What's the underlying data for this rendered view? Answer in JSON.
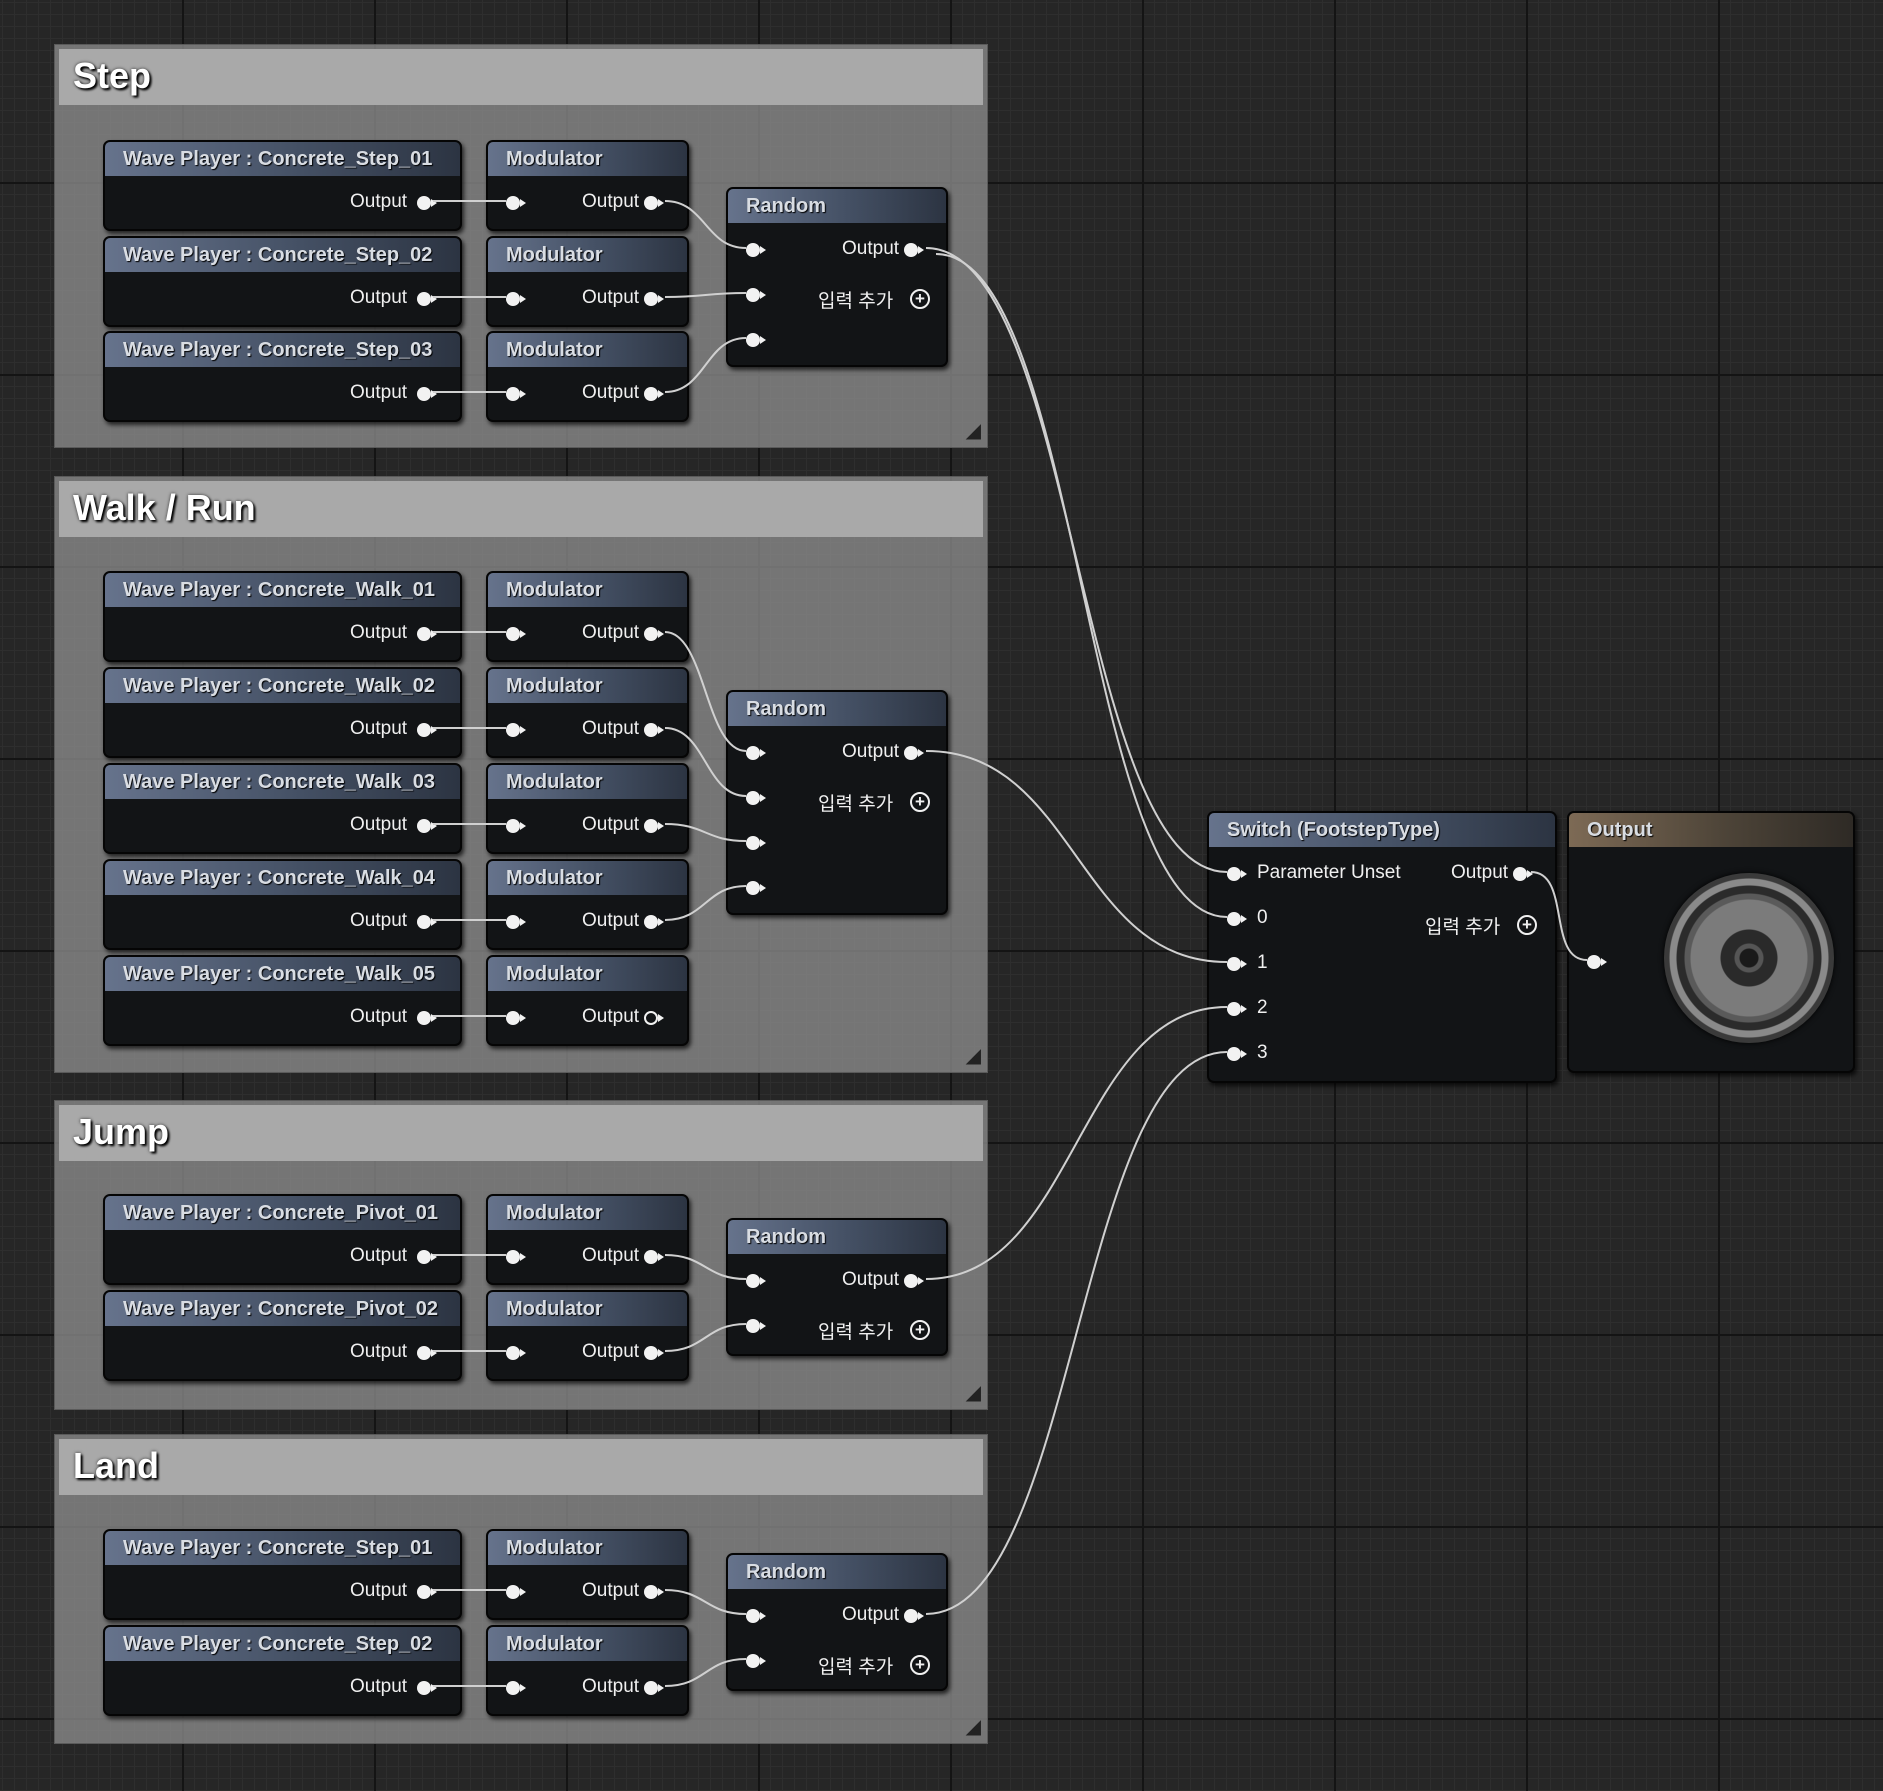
{
  "groups": [
    {
      "title": "Step",
      "wave_players": [
        "Wave Player : Concrete_Step_01",
        "Wave Player : Concrete_Step_02",
        "Wave Player : Concrete_Step_03"
      ]
    },
    {
      "title": "Walk / Run",
      "wave_players": [
        "Wave Player : Concrete_Walk_01",
        "Wave Player : Concrete_Walk_02",
        "Wave Player : Concrete_Walk_03",
        "Wave Player : Concrete_Walk_04",
        "Wave Player : Concrete_Walk_05"
      ]
    },
    {
      "title": "Jump",
      "wave_players": [
        "Wave Player : Concrete_Pivot_01",
        "Wave Player : Concrete_Pivot_02"
      ]
    },
    {
      "title": "Land",
      "wave_players": [
        "Wave Player : Concrete_Step_01",
        "Wave Player : Concrete_Step_02"
      ]
    }
  ],
  "common": {
    "modulator_title": "Modulator",
    "output_label": "Output",
    "random_title": "Random",
    "add_input_label": "입력 추가",
    "add_icon": "⊕"
  },
  "switch_node": {
    "title": "Switch (FootstepType)",
    "inputs": [
      "Parameter Unset",
      "0",
      "1",
      "2",
      "3"
    ],
    "output_label": "Output",
    "add_input_label": "입력 추가"
  },
  "output_node": {
    "title": "Output",
    "icon": "speaker-icon"
  },
  "colors": {
    "node_header": "#4a5568",
    "output_header": "#6e5e4c",
    "wire": "#d0d0d0"
  }
}
